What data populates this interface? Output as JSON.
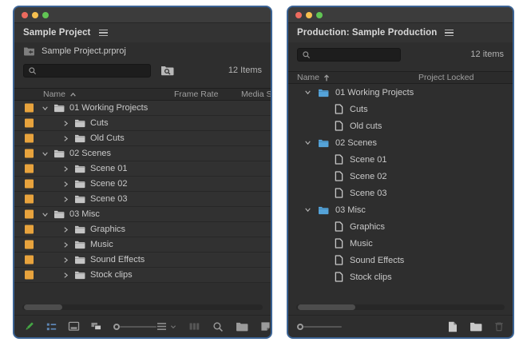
{
  "colors": {
    "accent_blue_border": "#3b6394",
    "label_orange": "#e8a33d",
    "folder_blue": "#55a3d9",
    "folder_gray": "#c4c4c4",
    "active_icon_blue": "#5d86b5",
    "pencil_green": "#44a544",
    "traffic_red": "#ec6a5e",
    "traffic_yellow": "#f5bf4f",
    "traffic_green": "#61c554"
  },
  "left_window": {
    "tab_title": "Sample Project",
    "project_file": "Sample Project.prproj",
    "search_value": "",
    "items_count": "12 Items",
    "columns": {
      "name": "Name",
      "frame_rate": "Frame Rate",
      "media_start": "Media S"
    },
    "sort": "name-ascending",
    "rows": [
      {
        "name": "01 Working Projects",
        "level": 0,
        "expanded": true,
        "icon": "bin-folder",
        "label_color": "orange"
      },
      {
        "name": "Cuts",
        "level": 1,
        "expanded": false,
        "icon": "bin-folder",
        "label_color": "orange"
      },
      {
        "name": "Old Cuts",
        "level": 1,
        "expanded": false,
        "icon": "bin-folder",
        "label_color": "orange"
      },
      {
        "name": "02 Scenes",
        "level": 0,
        "expanded": true,
        "icon": "bin-folder",
        "label_color": "orange"
      },
      {
        "name": "Scene 01",
        "level": 1,
        "expanded": false,
        "icon": "bin-folder",
        "label_color": "orange"
      },
      {
        "name": "Scene 02",
        "level": 1,
        "expanded": false,
        "icon": "bin-folder",
        "label_color": "orange"
      },
      {
        "name": "Scene 03",
        "level": 1,
        "expanded": false,
        "icon": "bin-folder",
        "label_color": "orange"
      },
      {
        "name": "03 Misc",
        "level": 0,
        "expanded": true,
        "icon": "bin-folder",
        "label_color": "orange"
      },
      {
        "name": "Graphics",
        "level": 1,
        "expanded": false,
        "icon": "bin-folder",
        "label_color": "orange"
      },
      {
        "name": "Music",
        "level": 1,
        "expanded": false,
        "icon": "bin-folder",
        "label_color": "orange"
      },
      {
        "name": "Sound Effects",
        "level": 1,
        "expanded": false,
        "icon": "bin-folder",
        "label_color": "orange"
      },
      {
        "name": "Stock clips",
        "level": 1,
        "expanded": false,
        "icon": "bin-folder",
        "label_color": "orange"
      }
    ],
    "toolbar_icons": [
      "project-writable-pencil",
      "list-view",
      "icon-view",
      "freeform-view",
      "zoom-slider",
      "sort-options",
      "automate-to-sequence",
      "find",
      "new-bin",
      "new-item"
    ]
  },
  "right_window": {
    "tab_title": "Production: Sample Production",
    "search_value": "",
    "items_count": "12 items",
    "columns": {
      "name": "Name",
      "project_locked": "Project Locked"
    },
    "sort": "name-ascending",
    "rows": [
      {
        "name": "01 Working Projects",
        "type": "folder",
        "expanded": true
      },
      {
        "name": "Cuts",
        "type": "project"
      },
      {
        "name": "Old cuts",
        "type": "project"
      },
      {
        "name": "02 Scenes",
        "type": "folder",
        "expanded": true
      },
      {
        "name": "Scene 01",
        "type": "project"
      },
      {
        "name": "Scene 02",
        "type": "project"
      },
      {
        "name": "Scene 03",
        "type": "project"
      },
      {
        "name": "03 Misc",
        "type": "folder",
        "expanded": true
      },
      {
        "name": "Graphics",
        "type": "project"
      },
      {
        "name": "Music",
        "type": "project"
      },
      {
        "name": "Sound Effects",
        "type": "project"
      },
      {
        "name": "Stock clips",
        "type": "project"
      }
    ],
    "toolbar_icons": [
      "zoom-slider",
      "new-project",
      "new-bin",
      "delete"
    ]
  }
}
